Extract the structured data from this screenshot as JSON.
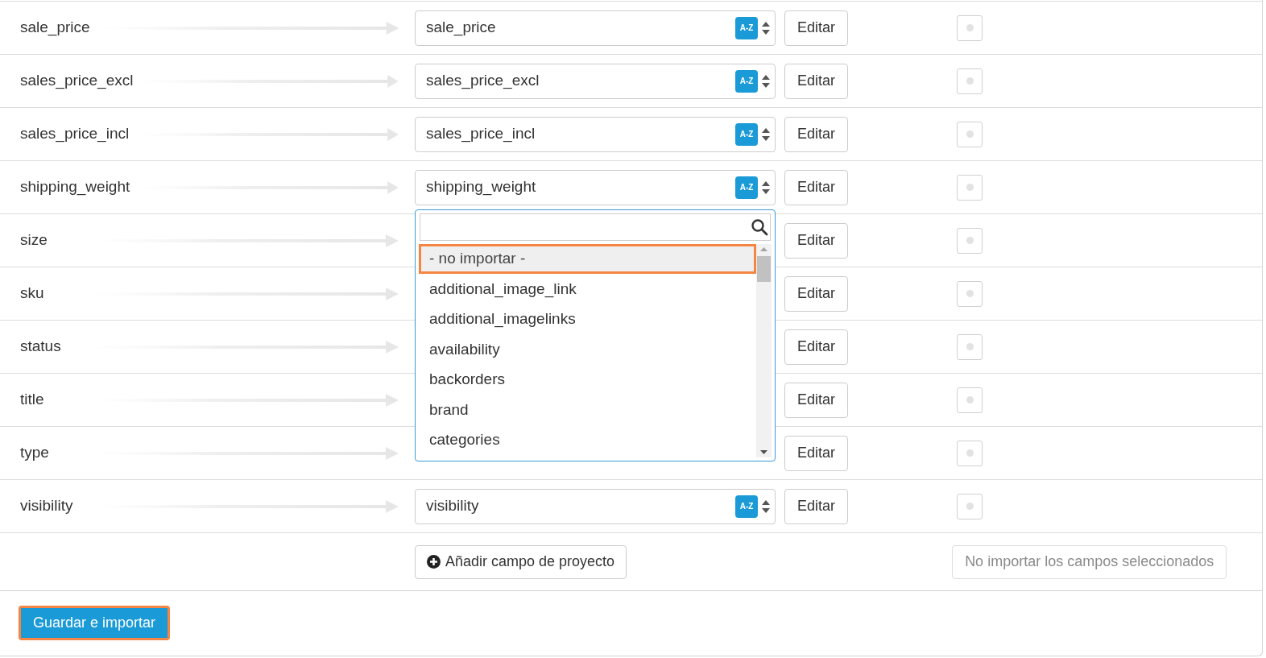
{
  "rows": [
    {
      "field": "sale_price",
      "select": {
        "value": "sale_price",
        "sort_label": "A-Z"
      },
      "edit_label": "Editar",
      "checked": false
    },
    {
      "field": "sales_price_excl",
      "select": {
        "value": "sales_price_excl",
        "sort_label": "A-Z"
      },
      "edit_label": "Editar",
      "checked": false
    },
    {
      "field": "sales_price_incl",
      "select": {
        "value": "sales_price_incl",
        "sort_label": "A-Z"
      },
      "edit_label": "Editar",
      "checked": false
    },
    {
      "field": "shipping_weight",
      "select": {
        "value": "shipping_weight",
        "sort_label": "A-Z",
        "open": true
      },
      "edit_label": "Editar",
      "checked": false
    },
    {
      "field": "size",
      "edit_label": "Editar",
      "checked": false
    },
    {
      "field": "sku",
      "edit_label": "Editar",
      "checked": false
    },
    {
      "field": "status",
      "edit_label": "Editar",
      "checked": false
    },
    {
      "field": "title",
      "edit_label": "Editar",
      "checked": false
    },
    {
      "field": "type",
      "edit_label": "Editar",
      "checked": false
    },
    {
      "field": "visibility",
      "select": {
        "value": "visibility",
        "sort_label": "A-Z"
      },
      "edit_label": "Editar",
      "checked": false
    }
  ],
  "dropdown": {
    "options": [
      {
        "label": "- no importar -",
        "selected": true
      },
      {
        "label": "additional_image_link",
        "selected": false
      },
      {
        "label": "additional_imagelinks",
        "selected": false
      },
      {
        "label": "availability",
        "selected": false
      },
      {
        "label": "backorders",
        "selected": false
      },
      {
        "label": "brand",
        "selected": false
      },
      {
        "label": "categories",
        "selected": false
      }
    ]
  },
  "add_button": "Añadir campo de proyecto",
  "skip_button": {
    "label": "No importar los campos seleccionados",
    "disabled": true
  },
  "save_button": "Guardar e importar"
}
